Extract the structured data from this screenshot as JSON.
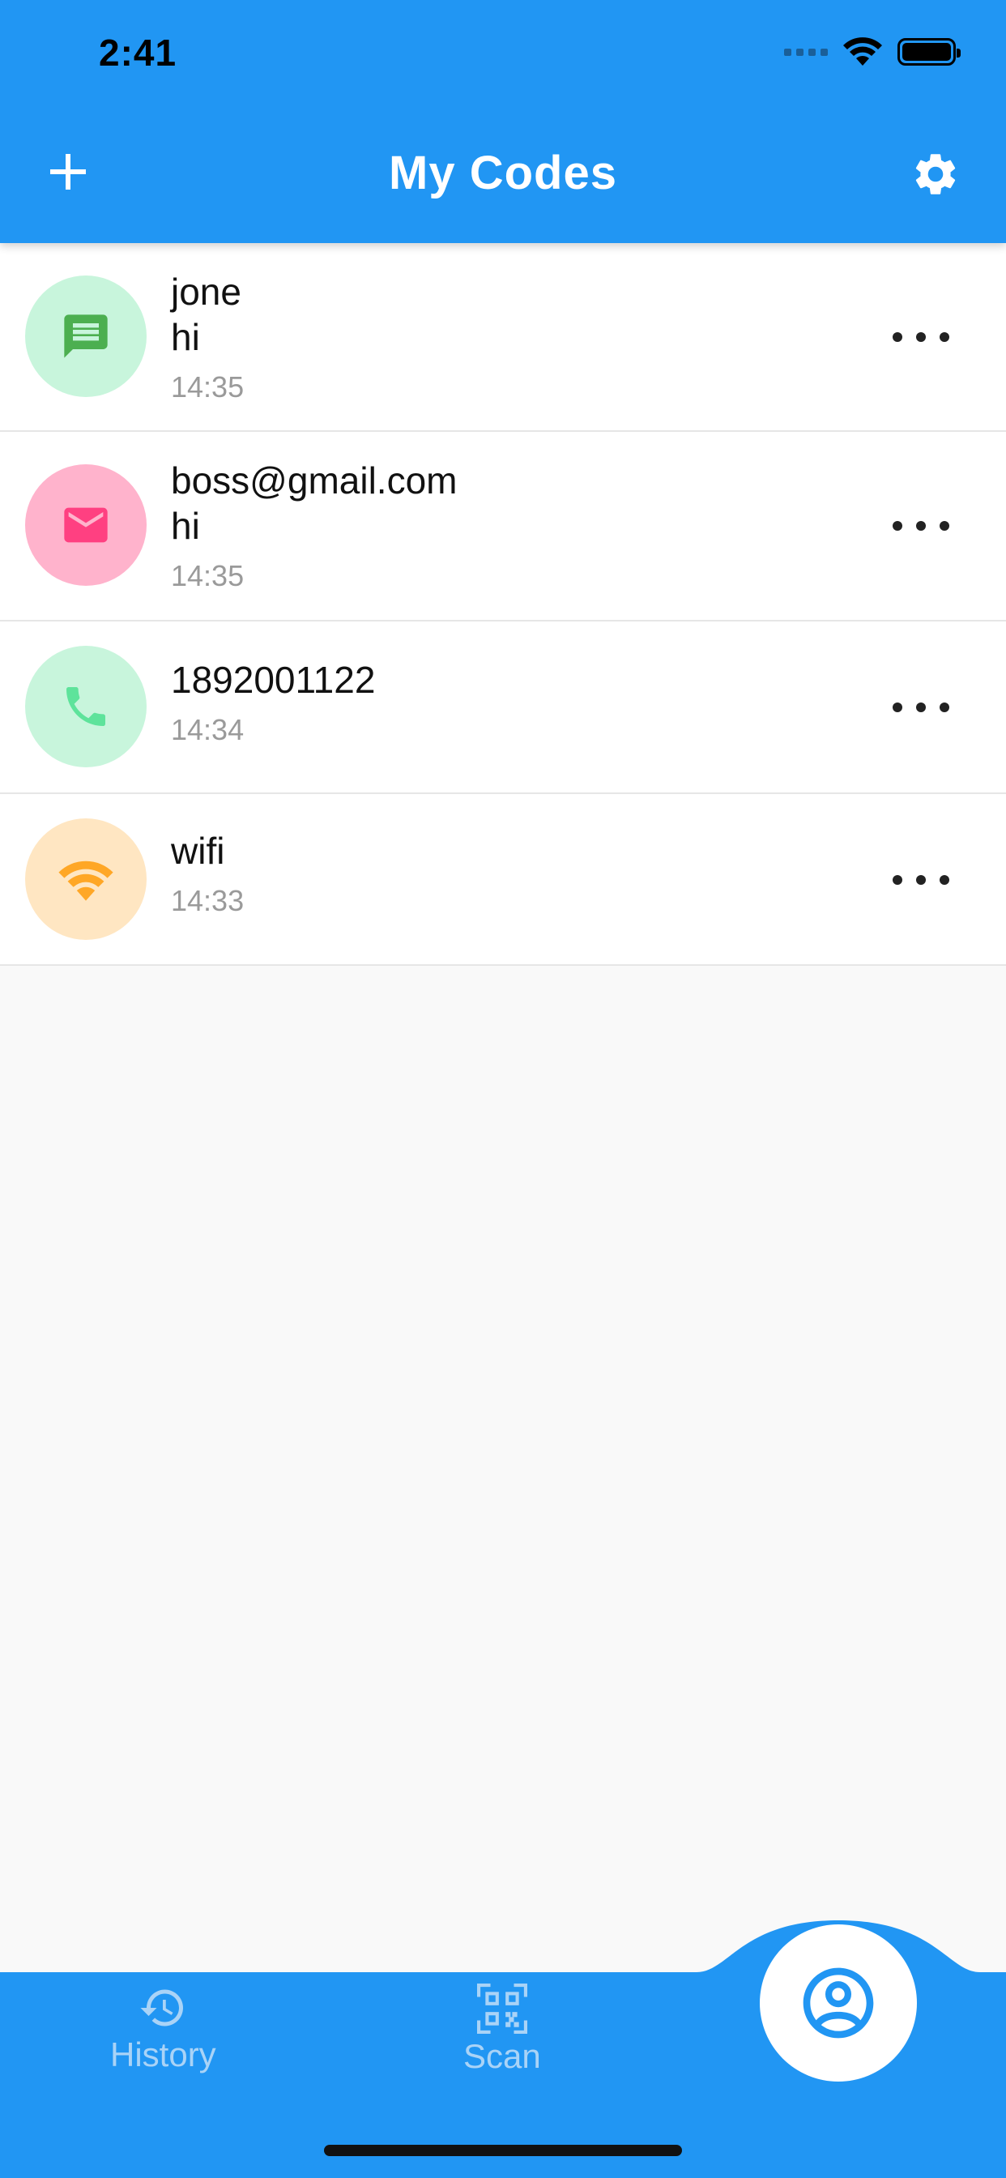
{
  "status_bar": {
    "time": "2:41"
  },
  "app_bar": {
    "title": "My Codes"
  },
  "codes": [
    {
      "type": "message",
      "icon": "message-icon",
      "title": "jone",
      "subtitle": "hi",
      "time": "14:35",
      "icon_bg": "#c8f5dc",
      "icon_color": "#4caf50"
    },
    {
      "type": "email",
      "icon": "mail-icon",
      "title": "boss@gmail.com",
      "subtitle": "hi",
      "time": "14:35",
      "icon_bg": "#ffb3cc",
      "icon_color": "#ff4081"
    },
    {
      "type": "phone",
      "icon": "phone-icon",
      "title": "1892001122",
      "subtitle": "",
      "time": "14:34",
      "icon_bg": "#c8f5dc",
      "icon_color": "#5ee39b"
    },
    {
      "type": "wifi",
      "icon": "wifi-icon",
      "title": "wifi",
      "subtitle": "",
      "time": "14:33",
      "icon_bg": "#ffe6c2",
      "icon_color": "#ffa726"
    }
  ],
  "bottom_nav": {
    "history_label": "History",
    "scan_label": "Scan",
    "active": "my-codes"
  },
  "colors": {
    "primary": "#2196f3",
    "nav_inactive": "#a9d3f7",
    "background": "#f9f9f9"
  }
}
